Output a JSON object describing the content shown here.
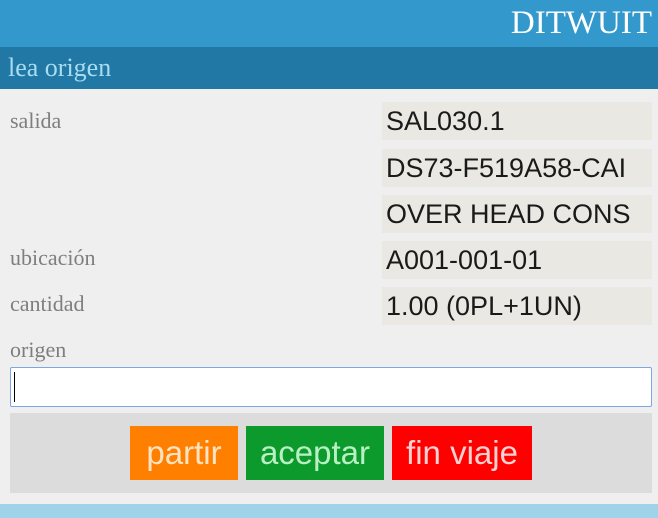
{
  "header": {
    "title": "DITWUIT"
  },
  "subheader": {
    "title": "lea origen"
  },
  "fields": {
    "salida_label": "salida",
    "salida_values": [
      "SAL030.1",
      "DS73-F519A58-CAI",
      "OVER HEAD CONS"
    ],
    "ubicacion_label": "ubicación",
    "ubicacion_value": "A001-001-01",
    "cantidad_label": "cantidad",
    "cantidad_value": "1.00 (0PL+1UN)",
    "origen_label": "origen",
    "origen_value": ""
  },
  "buttons": {
    "partir": "partir",
    "aceptar": "aceptar",
    "fin_viaje": "fin viaje"
  },
  "colors": {
    "header_bg": "#3399cc",
    "subheader_bg": "#2278a5",
    "partir_bg": "#ff8000",
    "aceptar_bg": "#0c9a2c",
    "fin_viaje_bg": "#ff0000"
  }
}
